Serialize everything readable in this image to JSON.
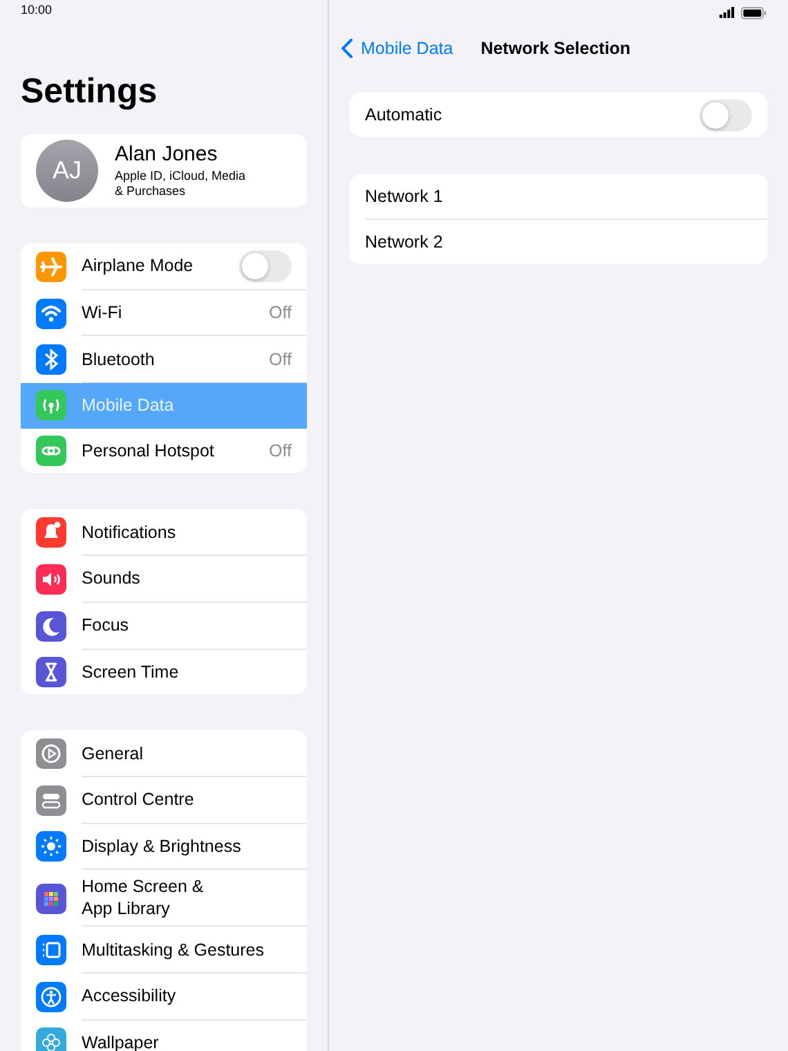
{
  "status_bar": {
    "time": "10:00"
  },
  "sidebar": {
    "title": "Settings",
    "profile": {
      "initials": "AJ",
      "name": "Alan Jones",
      "subtitle": "Apple ID, iCloud, Media\n& Purchases"
    },
    "groups": [
      {
        "items": [
          {
            "label": "Airplane Mode",
            "color": "#ff9500",
            "kind": "toggle",
            "on": false,
            "selected": false
          },
          {
            "label": "Wi-Fi",
            "color": "#007aff",
            "kind": "value",
            "value": "Off",
            "selected": false
          },
          {
            "label": "Bluetooth",
            "color": "#007aff",
            "kind": "value",
            "value": "Off",
            "selected": false
          },
          {
            "label": "Mobile Data",
            "color": "#34c759",
            "kind": "plain",
            "selected": true
          },
          {
            "label": "Personal Hotspot",
            "color": "#34c759",
            "kind": "value",
            "value": "Off",
            "selected": false
          }
        ]
      },
      {
        "items": [
          {
            "label": "Notifications",
            "color": "#ff3b30",
            "kind": "plain",
            "selected": false
          },
          {
            "label": "Sounds",
            "color": "#ff2d55",
            "kind": "plain",
            "selected": false
          },
          {
            "label": "Focus",
            "color": "#5856d6",
            "kind": "plain",
            "selected": false
          },
          {
            "label": "Screen Time",
            "color": "#5856d6",
            "kind": "plain",
            "selected": false
          }
        ]
      },
      {
        "items": [
          {
            "label": "General",
            "color": "#8e8e93",
            "kind": "plain",
            "selected": false
          },
          {
            "label": "Control Centre",
            "color": "#8e8e93",
            "kind": "plain",
            "selected": false
          },
          {
            "label": "Display & Brightness",
            "color": "#007aff",
            "kind": "plain",
            "selected": false
          },
          {
            "label": "Home Screen &\nApp Library",
            "color": "#5856d6",
            "kind": "plain",
            "selected": false
          },
          {
            "label": "Multitasking & Gestures",
            "color": "#007aff",
            "kind": "plain",
            "selected": false
          },
          {
            "label": "Accessibility",
            "color": "#007aff",
            "kind": "plain",
            "selected": false
          },
          {
            "label": "Wallpaper",
            "color": "#34aadc",
            "kind": "plain",
            "selected": false
          }
        ]
      }
    ]
  },
  "detail": {
    "back": "Mobile Data",
    "title": "Network Selection",
    "automatic": {
      "label": "Automatic",
      "on": false
    },
    "networks": [
      {
        "label": "Network 1"
      },
      {
        "label": "Network 2"
      }
    ]
  }
}
